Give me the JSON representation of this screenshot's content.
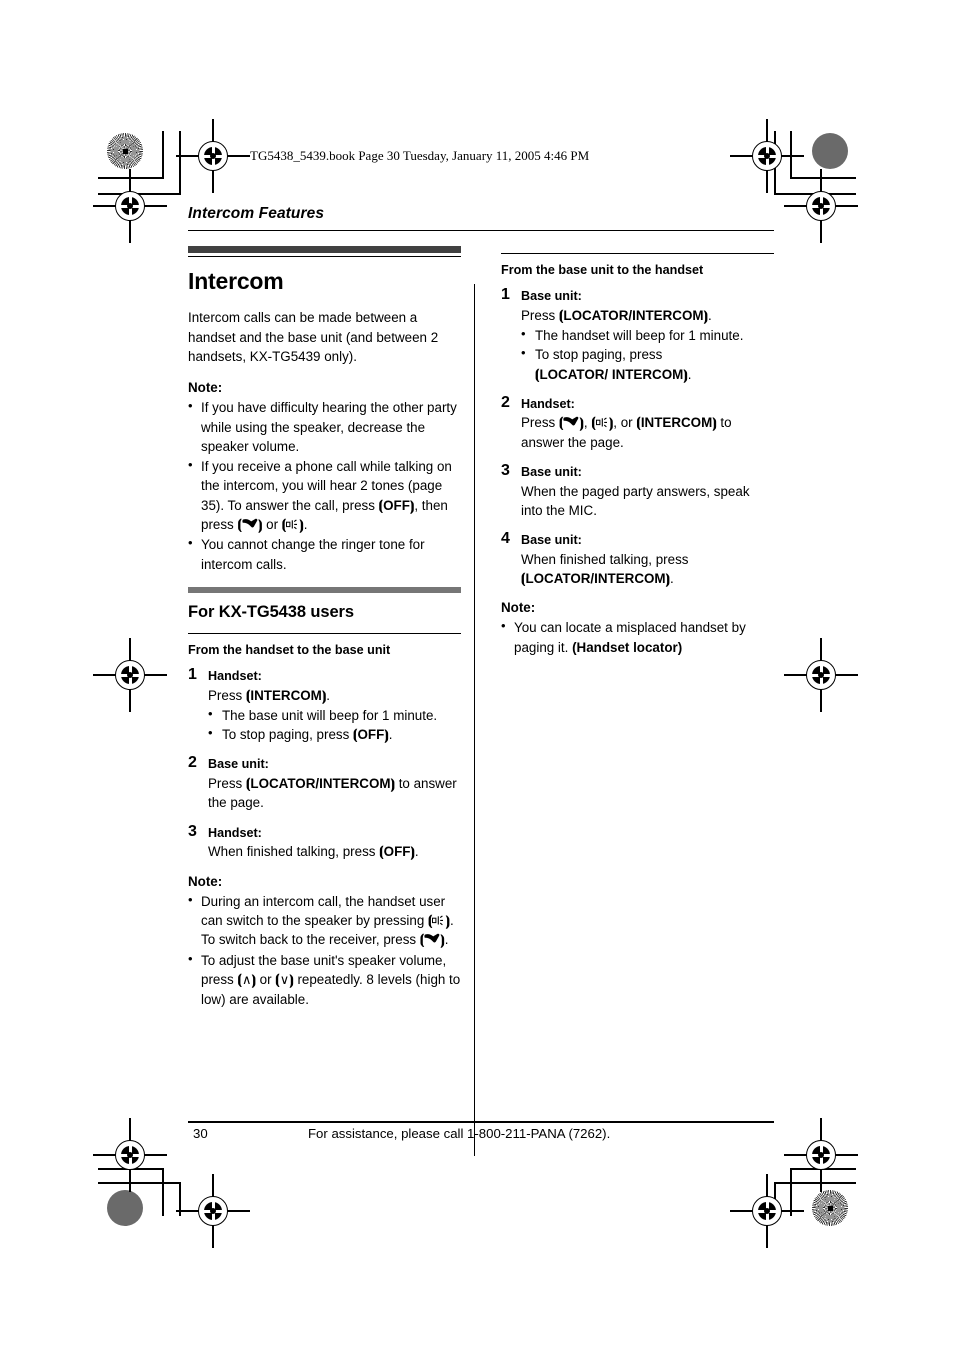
{
  "file_header": "TG5438_5439.book  Page 30  Tuesday, January 11, 2005  4:46 PM",
  "running_head": "Intercom Features",
  "left_column": {
    "chapter_title": "Intercom",
    "intro": "Intercom calls can be made between a handset and the base unit (and between 2 handsets, KX-TG5439 only).",
    "note_label": "Note:",
    "notes": [
      "If you have difficulty hearing the other party while using the speaker, decrease the speaker volume.",
      "If you receive a phone call while talking on the intercom, you will hear 2 tones (page 35). To answer the call, press {OFF}, then press {talk-glyph} or {speakerphone-glyph}.",
      "You cannot change the ringer tone for intercom calls."
    ],
    "section_title": "For KX-TG5438 users",
    "subsection_title": "From the handset to the base unit",
    "steps": [
      {
        "num": "1",
        "role": "Handset:",
        "text": "Press {INTERCOM}.",
        "bullets": [
          "The base unit will beep for 1 minute.",
          "To stop paging, press {OFF}."
        ]
      },
      {
        "num": "2",
        "role": "Base unit:",
        "text": "Press {LOCATOR/INTERCOM} to answer the page.",
        "bullets": []
      },
      {
        "num": "3",
        "role": "Handset:",
        "text": "When finished talking, press {OFF}.",
        "bullets": []
      }
    ],
    "note2_label": "Note:",
    "notes2": [
      "During an intercom call, the handset user can switch to the speaker by pressing {speakerphone-glyph}. To switch back to the receiver, press {talk-glyph}.",
      "To adjust the base unit's speaker volume, press {up-chevron} or {down-chevron} repeatedly. 8 levels (high to low) are available."
    ]
  },
  "right_column": {
    "subsection_title": "From the base unit to the handset",
    "steps": [
      {
        "num": "1",
        "role": "Base unit:",
        "text": "Press {LOCATOR/INTERCOM}.",
        "bullets": [
          "The handset will beep for 1 minute.",
          "To stop paging, press {LOCATOR/INTERCOM}."
        ]
      },
      {
        "num": "2",
        "role": "Handset:",
        "text": "Press {talk-glyph}, {speakerphone-glyph}, or {INTERCOM} to answer the page.",
        "bullets": []
      },
      {
        "num": "3",
        "role": "Base unit:",
        "text": "When the paged party answers, speak into the MIC.",
        "bullets": []
      },
      {
        "num": "4",
        "role": "Base unit:",
        "text": "When finished talking, press {LOCATOR/INTERCOM}.",
        "bullets": []
      }
    ],
    "note_label": "Note:",
    "notes": [
      "You can locate a misplaced handset by paging it. (Handset locator)"
    ]
  },
  "footer": {
    "page_number": "30",
    "assistance_text": "For assistance, please call 1-800-211-PANA (7262)."
  },
  "key_labels": {
    "off": "OFF",
    "intercom": "INTERCOM",
    "locator_intercom": "LOCATOR/INTERCOM",
    "handset_locator": "(Handset locator)"
  },
  "colors": {
    "chapter_rule": "#414141",
    "section_rule": "#767676",
    "text": "#000000",
    "page_background": "#ffffff"
  }
}
